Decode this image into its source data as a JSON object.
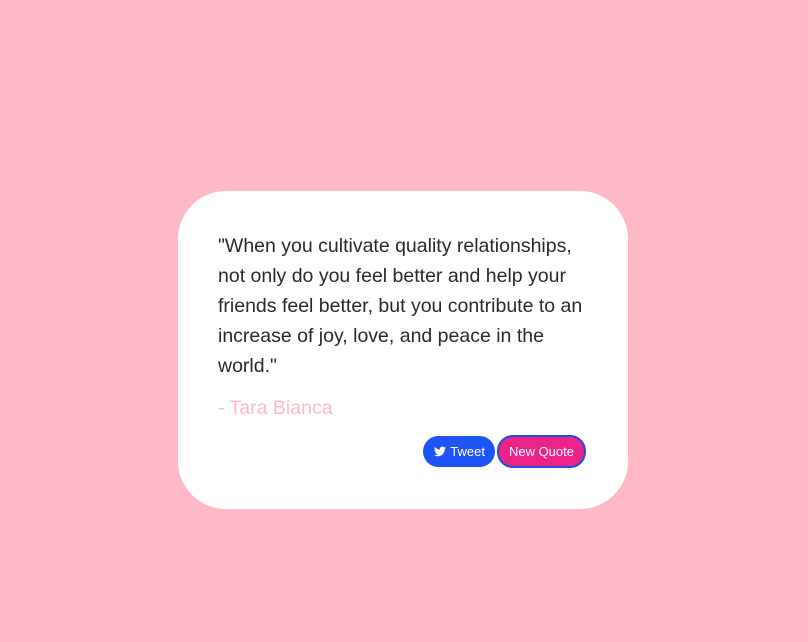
{
  "quote": {
    "text": "\"When you cultivate quality relationships, not only do you feel better and help your friends feel better, but you contribute to an increase of joy, love, and peace in the world.\"",
    "author": "- Tara Bianca"
  },
  "actions": {
    "tweet_label": "Tweet",
    "tweet_icon": "twitter-icon",
    "new_quote_label": "New Quote"
  },
  "colors": {
    "background": "#ffb8c6",
    "card": "#ffffff",
    "author_text": "#ffb8c6",
    "tweet_button": "#1d54f5",
    "new_quote_button": "#ec2489"
  }
}
